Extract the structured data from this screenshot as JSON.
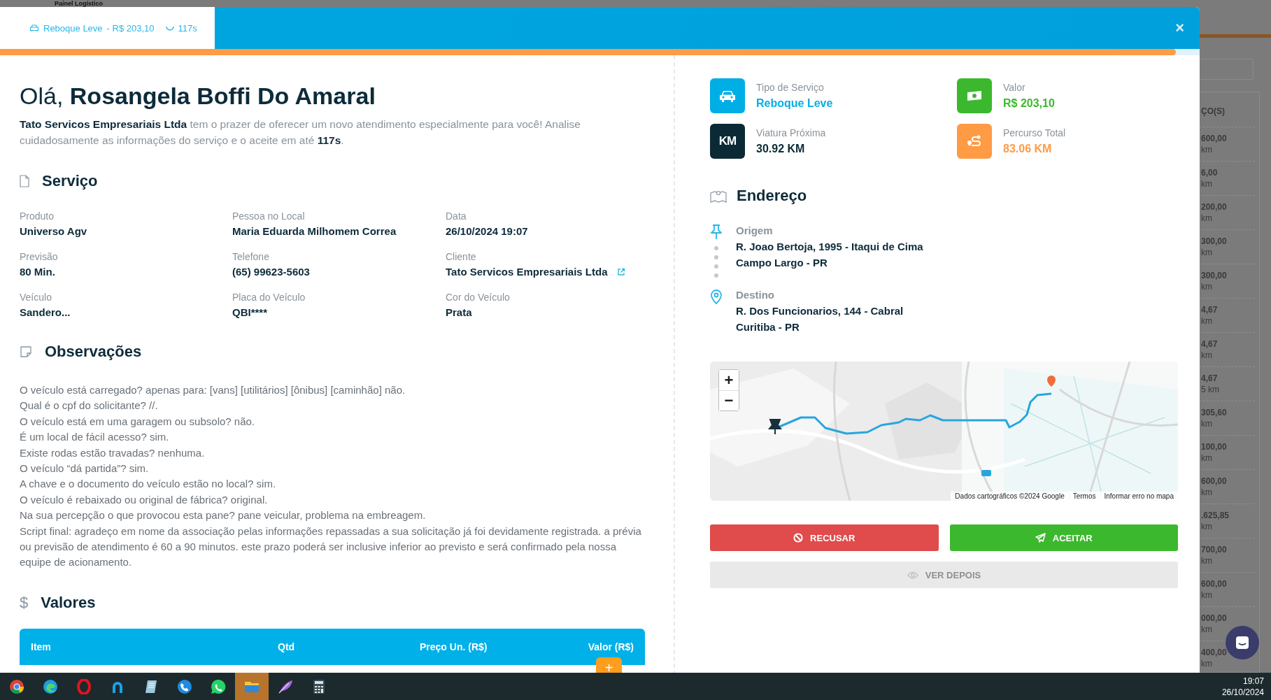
{
  "background": {
    "title": "Painel Logístico",
    "column_header": "ÇO(S)",
    "rows": [
      {
        "price": "600,00",
        "distance": "km"
      },
      {
        "price": "6,00",
        "distance": "km"
      },
      {
        "price": "200,00",
        "distance": "km"
      },
      {
        "price": "300,00",
        "distance": "km"
      },
      {
        "price": "300,00",
        "distance": "km"
      },
      {
        "price": "4,67",
        "distance": "km"
      },
      {
        "price": "4,67",
        "distance": "km"
      },
      {
        "price": "4,67",
        "distance": "5 km"
      },
      {
        "price": "305,60",
        "distance": "km"
      },
      {
        "price": "100,00",
        "distance": "km"
      },
      {
        "price": "600,00",
        "distance": "km"
      },
      {
        "price": ".625,85",
        "distance": "km"
      },
      {
        "price": "700,00",
        "distance": "km"
      },
      {
        "price": "600,00",
        "distance": "km"
      },
      {
        "price": "000,00",
        "distance": "km"
      },
      {
        "price": "400,00",
        "distance": "km"
      }
    ]
  },
  "modal": {
    "tab": {
      "service": "Reboque Leve",
      "price": "- R$ 203,10",
      "countdown": "117s"
    },
    "close": "×",
    "progress": {
      "level": 0.98
    },
    "greeting": {
      "prefix": "Olá,",
      "name": "Rosangela Boffi Do Amaral"
    },
    "intro": "**Tato Servicos Empresariais Ltda** tem o prazer de oferecer um novo atendimento especialmente para você! Analise cuidadosamente as informações do serviço e o aceite em até **117s**.",
    "service": {
      "heading": "Serviço",
      "fields": [
        {
          "label": "Produto",
          "value": "Universo Agv",
          "link": false
        },
        {
          "label": "Pessoa no Local",
          "value": "Maria Eduarda Milhomem Correa",
          "link": false
        },
        {
          "label": "Data",
          "value": "26/10/2024 19:07",
          "link": false
        },
        {
          "label": "Previsão",
          "value": "80 Min.",
          "link": false
        },
        {
          "label": "Telefone",
          "value": "(65) 99623-5603",
          "link": false
        },
        {
          "label": "Cliente",
          "value": "Tato Servicos Empresariais Ltda",
          "link": true
        },
        {
          "label": "Veículo",
          "value": "Sandero...",
          "link": false
        },
        {
          "label": "Placa do Veículo",
          "value": "QBI****",
          "link": false
        },
        {
          "label": "Cor do Veículo",
          "value": "Prata",
          "link": false
        }
      ]
    },
    "notes": {
      "heading": "Observações",
      "lines": [
        "O veículo está carregado? apenas para: [vans] [utilitários] [ônibus] [caminhão] não.",
        "Qual é o cpf do solicitante? //.",
        "O veículo está em uma garagem ou subsolo? não.",
        "É um local de fácil acesso? sim.",
        "Existe rodas estão travadas? nenhuma.",
        "O veículo “dá partida”? sim.",
        "A chave e o documento do veículo estão no local? sim.",
        "O veículo é rebaixado ou original de fábrica? original.",
        "Na sua percepção o que provocou esta pane? pane veicular, problema na embreagem.",
        "Script final: agradeço em nome da associação pelas informações repassadas a sua solicitação já foi devidamente registrada. a prévia ou previsão de atendimento é 60 a 90 minutos. este prazo poderá ser inclusive inferior ao previsto e será confirmado pela nossa equipe de acionamento."
      ]
    },
    "values": {
      "icon": "$",
      "heading": "Valores",
      "columns": [
        "Item",
        "Qtd",
        "Preço Un. (R$)",
        "Valor (R$)"
      ],
      "add_button": "+"
    },
    "summary": [
      {
        "kind": "car",
        "label": "Tipo de Serviço",
        "value": "Reboque Leve",
        "color": "#00aee6"
      },
      {
        "kind": "money",
        "label": "Valor",
        "value": "R$ 203,10",
        "color": "#3cb82e"
      },
      {
        "kind": "km",
        "icon_text": "KM",
        "label": "Viatura Próxima",
        "value": "30.92 KM",
        "color": "#0b2a36"
      },
      {
        "kind": "route",
        "label": "Percurso Total",
        "value": "83.06 KM",
        "color": "#ff9a45"
      }
    ],
    "address": {
      "heading": "Endereço",
      "stops": [
        {
          "kind": "origin",
          "label": "Origem",
          "lines": [
            "R. Joao Bertoja, 1995 - Itaqui de Cima",
            "Campo Largo - PR"
          ]
        },
        {
          "kind": "destination",
          "label": "Destino",
          "lines": [
            "R. Dos Funcionarios, 144 - Cabral",
            "Curitiba - PR"
          ]
        }
      ]
    },
    "map": {
      "kind": "picture",
      "zoom_in": "+",
      "zoom_out": "−",
      "attribution": [
        "Dados cartográficos ©2024 Google",
        "Termos",
        "Informar erro no mapa"
      ]
    },
    "actions": [
      {
        "kind": "reject",
        "label": "RECUSAR",
        "disabled": false
      },
      {
        "kind": "accept",
        "label": "ACEITAR",
        "disabled": false
      },
      {
        "kind": "later",
        "label": "VER DEPOIS",
        "disabled": true
      }
    ]
  },
  "taskbar": {
    "apps": [
      {
        "selected": false
      },
      {
        "selected": false
      },
      {
        "selected": false
      },
      {
        "selected": false
      },
      {
        "selected": false
      },
      {
        "selected": false
      },
      {
        "selected": false
      },
      {
        "selected": true
      },
      {
        "selected": false
      },
      {
        "selected": false
      }
    ],
    "time": "19:07",
    "date": "26/10/2024"
  }
}
